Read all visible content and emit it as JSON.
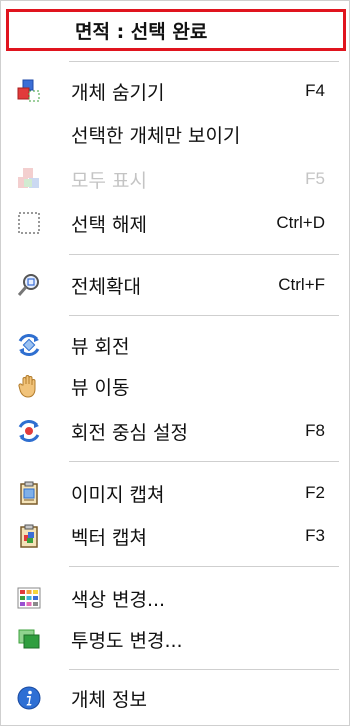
{
  "header": {
    "title": "면적 : 선택 완료"
  },
  "menu": {
    "items": [
      {
        "label": "개체 숨기기",
        "shortcut": "F4",
        "icon": "hide-object-icon"
      },
      {
        "label": "선택한 개체만 보이기",
        "shortcut": "",
        "icon": ""
      },
      {
        "label": "모두 표시",
        "shortcut": "F5",
        "icon": "show-all-icon",
        "disabled": true
      },
      {
        "label": "선택 해제",
        "shortcut": "Ctrl+D",
        "icon": "deselect-icon"
      },
      {
        "label": "전체확대",
        "shortcut": "Ctrl+F",
        "icon": "zoom-all-icon"
      },
      {
        "label": "뷰 회전",
        "shortcut": "",
        "icon": "rotate-view-icon"
      },
      {
        "label": "뷰 이동",
        "shortcut": "",
        "icon": "pan-hand-icon"
      },
      {
        "label": "회전 중심 설정",
        "shortcut": "F8",
        "icon": "rotation-center-icon"
      },
      {
        "label": "이미지 캡쳐",
        "shortcut": "F2",
        "icon": "image-capture-icon"
      },
      {
        "label": "벡터 캡쳐",
        "shortcut": "F3",
        "icon": "vector-capture-icon"
      },
      {
        "label": "색상 변경...",
        "shortcut": "",
        "icon": "color-palette-icon"
      },
      {
        "label": "투명도 변경...",
        "shortcut": "",
        "icon": "transparency-icon"
      },
      {
        "label": "개체 정보",
        "shortcut": "",
        "icon": "info-icon"
      }
    ]
  }
}
